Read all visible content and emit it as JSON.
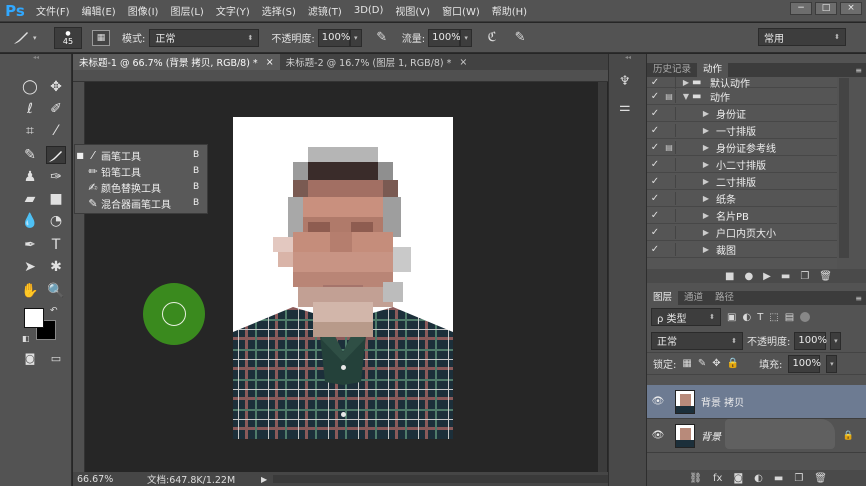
{
  "app": {
    "logo": "Ps"
  },
  "menu": [
    "文件(F)",
    "编辑(E)",
    "图像(I)",
    "图层(L)",
    "文字(Y)",
    "选择(S)",
    "滤镜(T)",
    "3D(D)",
    "视图(V)",
    "窗口(W)",
    "帮助(H)"
  ],
  "window_controls": {
    "minimize": "−",
    "restore": "□",
    "close": "×"
  },
  "options": {
    "brush_size": "45",
    "mode_label": "模式:",
    "mode_value": "正常",
    "opacity_label": "不透明度:",
    "opacity_value": "100%",
    "flow_label": "流量:",
    "flow_value": "100%",
    "workspace": "常用"
  },
  "tabs": [
    {
      "label": "未标题-1 @ 66.7% (背景 拷贝, RGB/8) *",
      "close": "×"
    },
    {
      "label": "未标题-2 @ 16.7% (图层 1, RGB/8) *",
      "close": "×"
    }
  ],
  "flyout": {
    "items": [
      {
        "bullet": "■",
        "label": "画笔工具",
        "key": "B"
      },
      {
        "bullet": "",
        "label": "铅笔工具",
        "key": "B"
      },
      {
        "bullet": "",
        "label": "颜色替换工具",
        "key": "B"
      },
      {
        "bullet": "",
        "label": "混合器画笔工具",
        "key": "B"
      }
    ]
  },
  "status": {
    "zoom": "66.67%",
    "doc": "文档:647.8K/1.22M"
  },
  "actions_panel": {
    "tabs": [
      "历史记录",
      "动作"
    ],
    "items": [
      {
        "label": "默认动作",
        "type": "set",
        "expanded": false
      },
      {
        "label": "动作",
        "type": "set",
        "expanded": true
      },
      {
        "label": "身份证",
        "type": "action"
      },
      {
        "label": "一寸排版",
        "type": "action"
      },
      {
        "label": "身份证参考线",
        "type": "action"
      },
      {
        "label": "小二寸排版",
        "type": "action"
      },
      {
        "label": "二寸排版",
        "type": "action"
      },
      {
        "label": "纸条",
        "type": "action"
      },
      {
        "label": "名片PB",
        "type": "action"
      },
      {
        "label": "户口内页大小",
        "type": "action"
      },
      {
        "label": "裁图",
        "type": "action"
      }
    ]
  },
  "layers_panel": {
    "tabs": [
      "图层",
      "通道",
      "路径"
    ],
    "filter_label": "ρ 类型",
    "blend_mode": "正常",
    "opacity_label": "不透明度:",
    "opacity_value": "100%",
    "lock_label": "锁定:",
    "fill_label": "填充:",
    "fill_value": "100%",
    "layers": [
      {
        "name": "背景 拷贝",
        "selected": true
      },
      {
        "name": "背景",
        "selected": false
      }
    ]
  },
  "colors": {
    "accent": "#31a8ff",
    "selected_layer": "#6d7b92",
    "brush_cursor": "#3a8a1e"
  }
}
